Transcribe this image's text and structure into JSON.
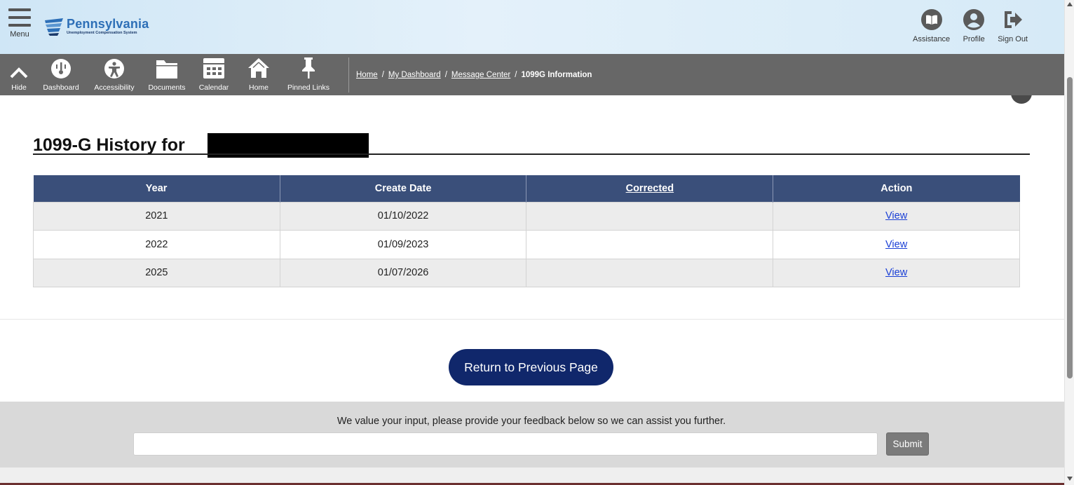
{
  "header": {
    "menu_label": "Menu",
    "logo_title": "Pennsylvania",
    "logo_subtitle": "Unemployment Compensation System",
    "actions": [
      {
        "label": "Assistance",
        "icon": "book-icon"
      },
      {
        "label": "Profile",
        "icon": "user-icon"
      },
      {
        "label": "Sign Out",
        "icon": "sign-out-icon"
      }
    ]
  },
  "toolbar": {
    "items": [
      {
        "label": "Hide",
        "icon": "chevron-up-icon"
      },
      {
        "label": "Dashboard",
        "icon": "dashboard-icon"
      },
      {
        "label": "Accessibility",
        "icon": "accessibility-icon"
      },
      {
        "label": "Documents",
        "icon": "folder-icon"
      },
      {
        "label": "Calendar",
        "icon": "calendar-icon"
      },
      {
        "label": "Home",
        "icon": "home-icon"
      },
      {
        "label": "Pinned Links",
        "icon": "pin-icon"
      }
    ],
    "breadcrumb": {
      "links": [
        "Home",
        "My Dashboard",
        "Message Center"
      ],
      "current": "1099G Information",
      "separator": "/"
    }
  },
  "main": {
    "title": "1099-G History for",
    "table": {
      "headers": [
        "Year",
        "Create Date",
        "Corrected",
        "Action"
      ],
      "rows": [
        {
          "year": "2021",
          "create_date": "01/10/2022",
          "corrected": "",
          "action": "View"
        },
        {
          "year": "2022",
          "create_date": "01/09/2023",
          "corrected": "",
          "action": "View"
        },
        {
          "year": "2025",
          "create_date": "01/07/2026",
          "corrected": "",
          "action": "View"
        }
      ]
    },
    "return_button": "Return to Previous Page"
  },
  "feedback": {
    "prompt": "We value your input, please provide your feedback below so we can assist you further.",
    "input_value": "",
    "submit_label": "Submit"
  },
  "colors": {
    "header_bg": "#d6eaf7",
    "toolbar_bg": "#676767",
    "table_header_bg": "#3a4f7a",
    "primary_button": "#10276b",
    "link": "#1a3fd6",
    "brand_blue": "#2d6fb7"
  }
}
